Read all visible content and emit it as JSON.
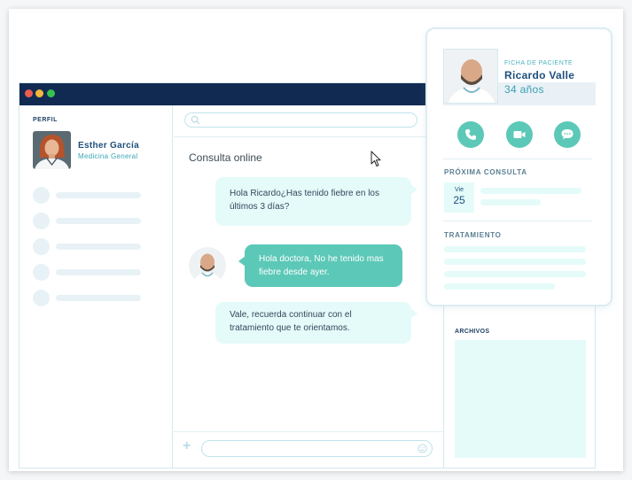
{
  "sidebar": {
    "section_label": "PERFIL",
    "doctor": {
      "name": "Esther García",
      "specialty": "Medicina General"
    }
  },
  "chat": {
    "title": "Consulta online",
    "messages": [
      {
        "from": "doctor",
        "text": "Hola Ricardo¿Has tenido fiebre en los últimos 3 días?"
      },
      {
        "from": "patient",
        "text": "Hola doctora, No he tenido mas fiebre desde ayer."
      },
      {
        "from": "doctor",
        "text": "Vale, recuerda continuar con el tratamiento que te orientamos."
      }
    ]
  },
  "patient_card": {
    "label": "FICHA DE PACIENTE",
    "name": "Ricardo Valle",
    "age": "34 años",
    "actions": [
      "phone-icon",
      "video-icon",
      "chat-icon"
    ],
    "next_appointment": {
      "label": "PRÓXIMA CONSULTA",
      "day": "Vie",
      "date": "25"
    },
    "treatment_label": "TRATAMIENTO"
  },
  "files": {
    "label": "ARCHIVOS"
  },
  "colors": {
    "titlebar": "#112a52",
    "accent": "#5cc8b8",
    "bubble_out": "#e4fbfa",
    "name_blue": "#1e4f7c"
  }
}
